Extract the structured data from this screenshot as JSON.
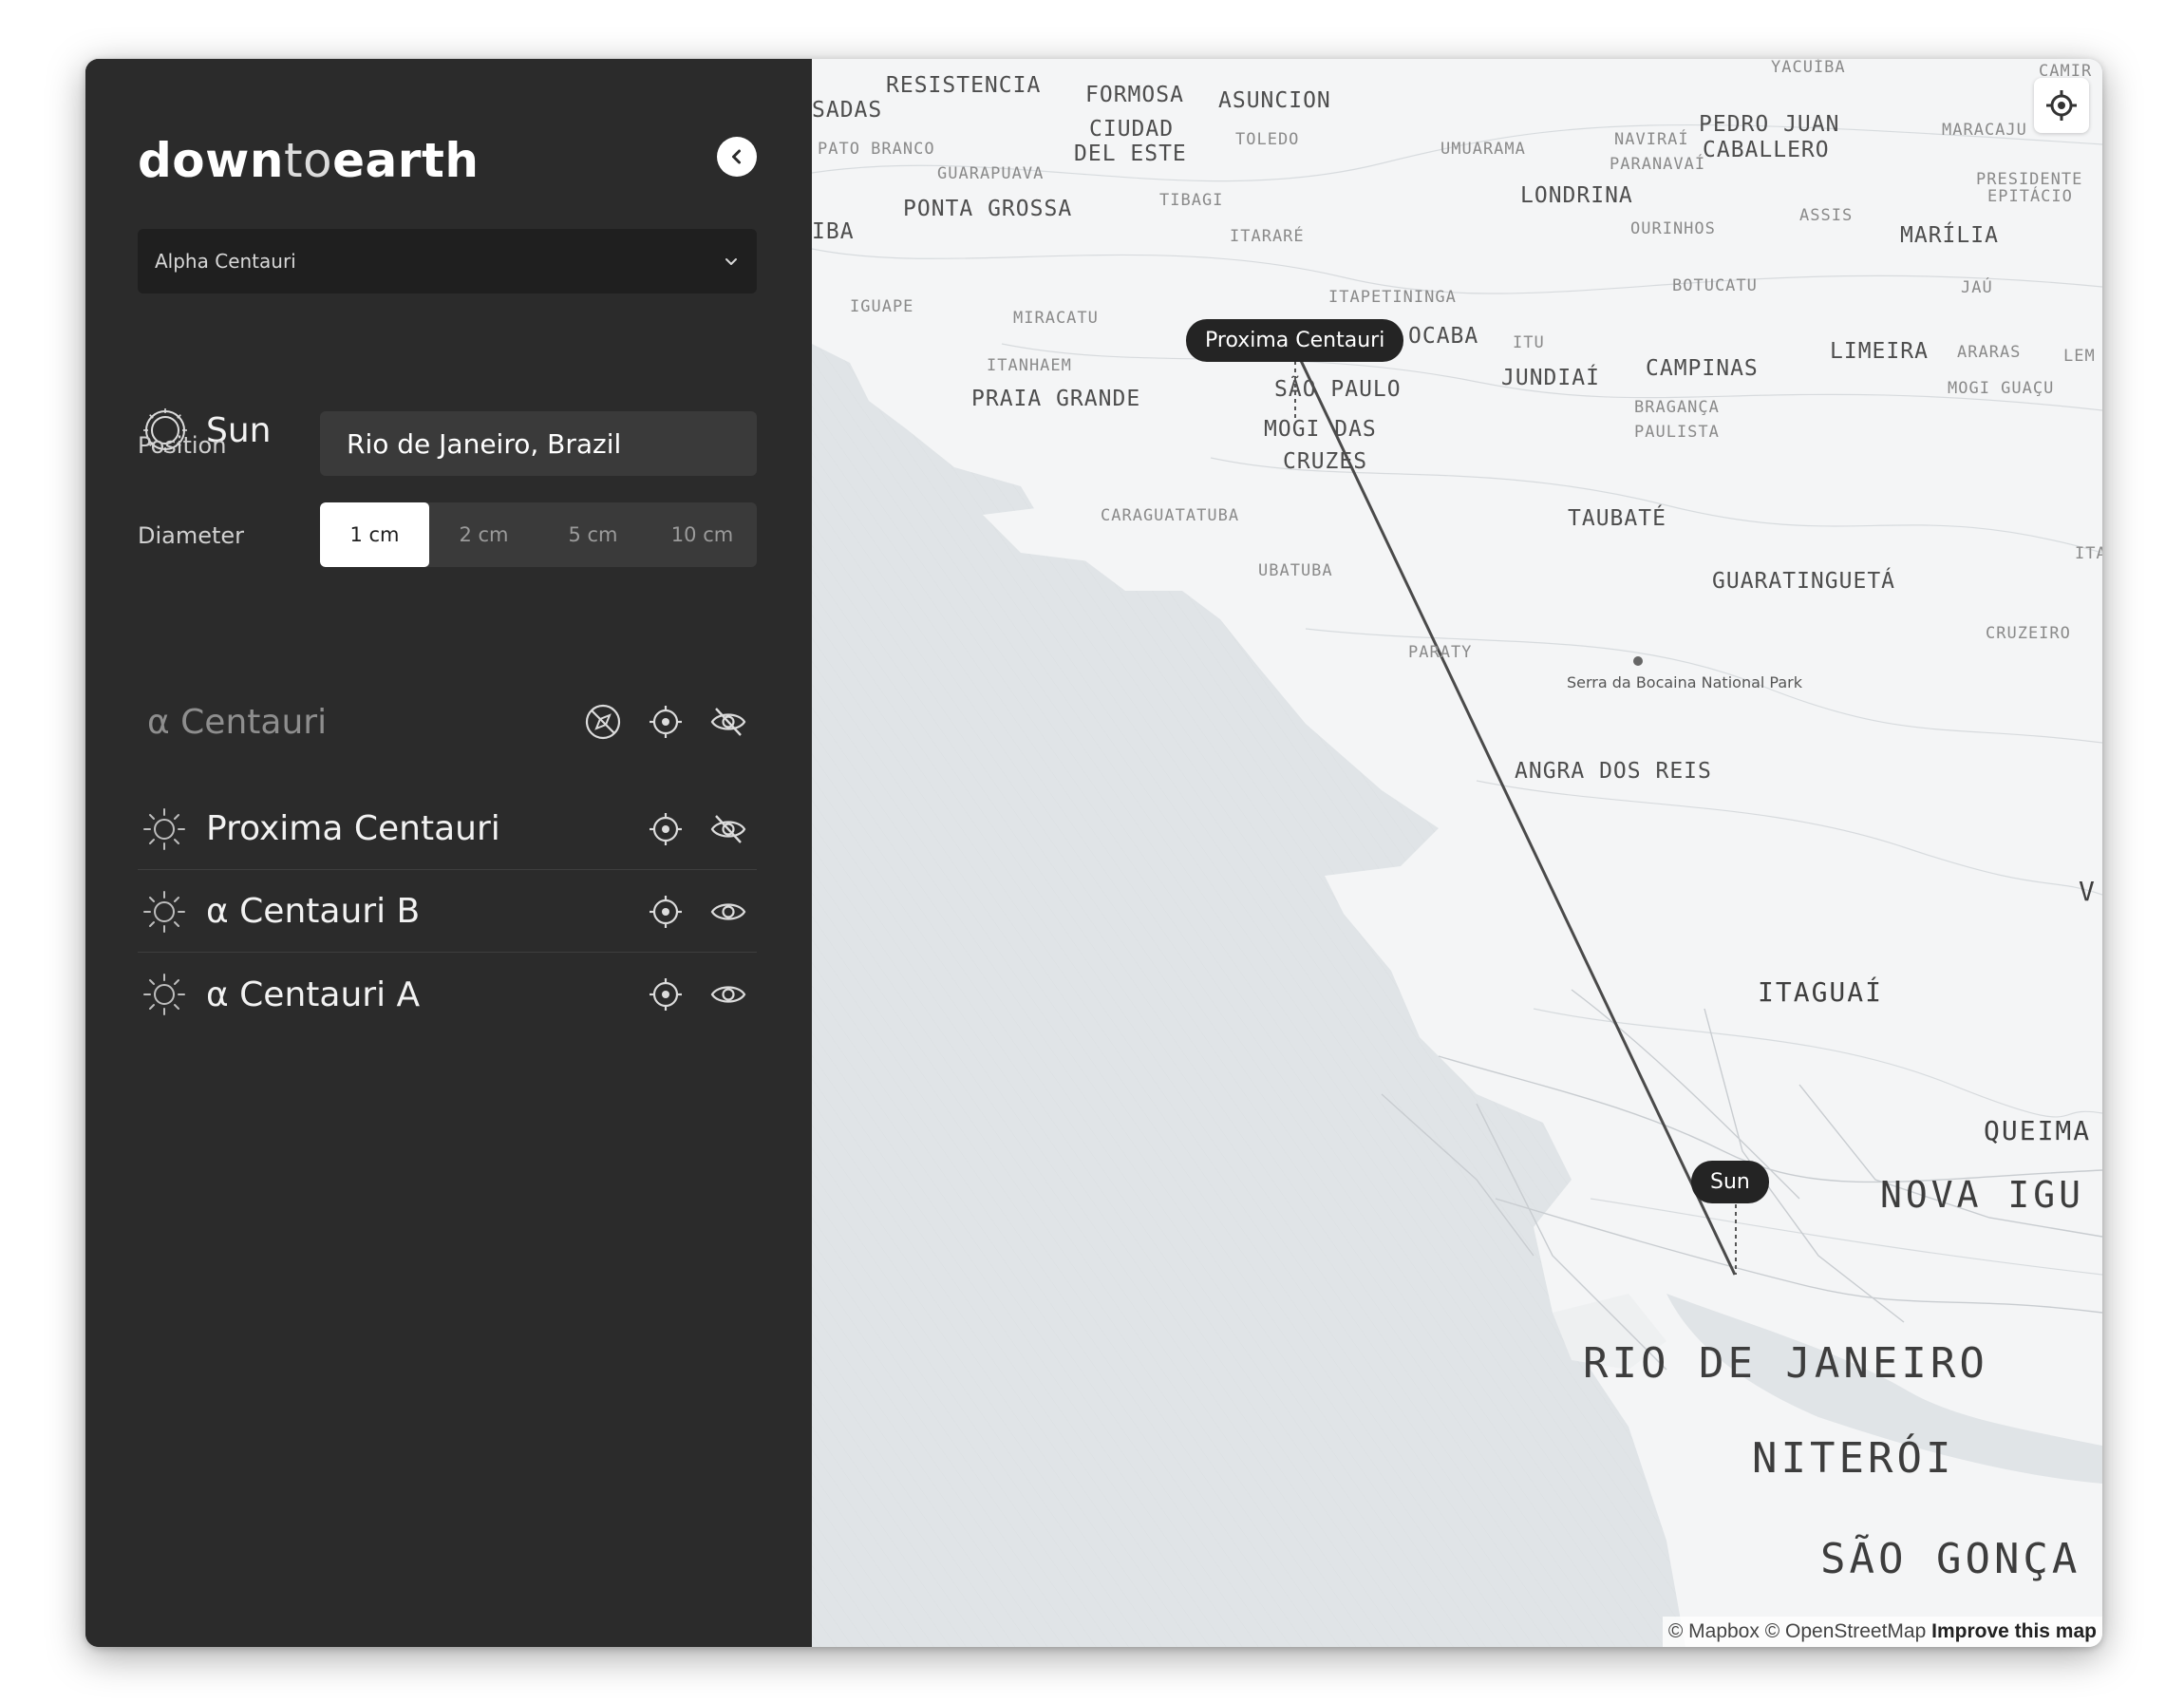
{
  "app": {
    "logo_bold_1": "down",
    "logo_thin": "to",
    "logo_bold_2": "earth"
  },
  "system_select": {
    "value": "Alpha Centauri"
  },
  "sun": {
    "label": "Sun",
    "position_label": "Position",
    "position_value": "Rio de Janeiro, Brazil",
    "diameter_label": "Diameter",
    "diameters": [
      "1 cm",
      "2 cm",
      "5 cm",
      "10 cm"
    ],
    "selected_diameter": "1 cm"
  },
  "system": {
    "label": "α Centauri"
  },
  "stars": [
    {
      "label": "Proxima Centauri",
      "visible": false
    },
    {
      "label": "α Centauri B",
      "visible": true
    },
    {
      "label": "α Centauri A",
      "visible": true
    }
  ],
  "map": {
    "tag_proxima": "Proxima Centauri",
    "tag_sun": "Sun",
    "places": {
      "resistencia": "RESISTENCIA",
      "sadas": "SADAS",
      "formosa": "FORMOSA",
      "asuncion": "ASUNCION",
      "yacuiba": "YACUÍBA",
      "camir": "CAMIR",
      "pato_branco": "PATO BRANCO",
      "ciudad": "CIUDAD",
      "del_este": "DEL ESTE",
      "toledo": "TOLEDO",
      "umuarama": "UMUARAMA",
      "navirai": "NAVIRAÍ",
      "pedro_juan": "PEDRO JUAN",
      "caballero": "CABALLERO",
      "maracaju": "MARACAJU",
      "guarapuava": "GUARAPUAVA",
      "paranavai": "PARANAVAÍ",
      "presidente": "PRESIDENTE",
      "epitacio": "EPITÁCIO",
      "londrina": "LONDRINA",
      "ponta_grossa": "PONTA GROSSA",
      "tibagi": "TIBAGI",
      "iba": "IBA",
      "ourinhos": "OURINHOS",
      "assis": "ASSIS",
      "marilia": "MARÍLIA",
      "itarare": "ITARARÉ",
      "botucatu": "BOTUCATU",
      "jau": "JAÚ",
      "iguape": "IGUAPE",
      "itapetininga": "ITAPETININGA",
      "miracatu": "MIRACATU",
      "ocaba": "OCABA",
      "itu": "ITU",
      "limeira": "LIMEIRA",
      "araras": "ARARAS",
      "lem": "LEM",
      "itanhaem": "ITANHAEM",
      "jundiai": "JUNDIAÍ",
      "campinas": "CAMPINAS",
      "mogi_guacu": "MOGI GUAÇU",
      "praia_grande": "PRAIA GRANDE",
      "sao_paulo": "SÃO PAULO",
      "braganca": "BRAGANÇA",
      "paulista": "PAULISTA",
      "mogi_das": "MOGI DAS",
      "cruzes": "CRUZES",
      "caraguatatuba": "CARAGUATATUBA",
      "taubate": "TAUBATÉ",
      "ita": "ITA",
      "ubatuba": "UBATUBA",
      "guaratingueta": "GUARATINGUETÁ",
      "paraty": "PARATY",
      "cruzeiro": "CRUZEIRO",
      "park": "Serra da Bocaina National Park",
      "angra": "ANGRA DOS REIS",
      "v": "V",
      "itaguai": "ITAGUAÍ",
      "queima": "QUEIMA",
      "nova_igu": "NOVA IGU",
      "rio": "RIO DE JANEIRO",
      "niteroi": "NITERÓI",
      "sao_gonca": "SÃO GONÇA"
    },
    "attribution_1": "© Mapbox © OpenStreetMap",
    "attribution_2": "Improve this map"
  }
}
